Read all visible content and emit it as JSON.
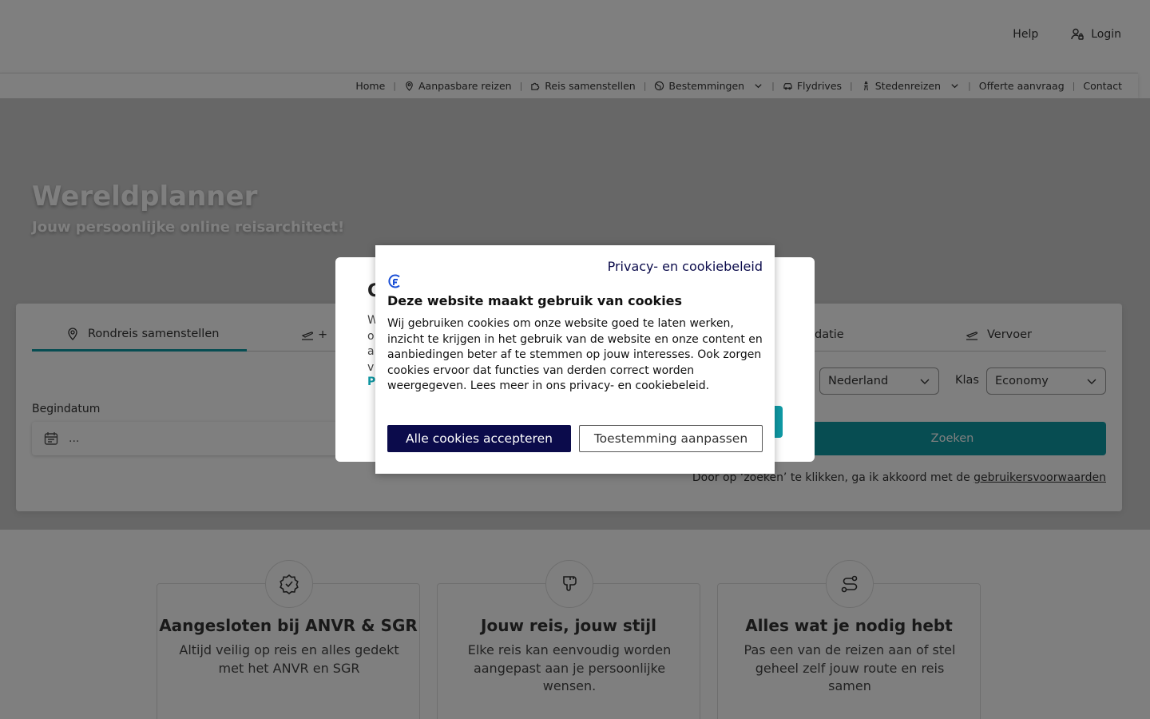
{
  "header": {
    "help": "Help",
    "login": "Login"
  },
  "nav": {
    "items": [
      {
        "label": "Home",
        "icon": ""
      },
      {
        "label": "Aanpasbare reizen",
        "icon": "map-pin-icon"
      },
      {
        "label": "Reis samenstellen",
        "icon": "puzzle-icon"
      },
      {
        "label": "Bestemmingen",
        "icon": "globe-icon",
        "dropdown": true
      },
      {
        "label": "Flydrives",
        "icon": "car-icon"
      },
      {
        "label": "Stedenreizen",
        "icon": "tower-icon",
        "dropdown": true
      },
      {
        "label": "Offerte aanvraag",
        "icon": ""
      },
      {
        "label": "Contact",
        "icon": ""
      }
    ]
  },
  "hero": {
    "title": "Wereldplanner",
    "subtitle": "Jouw persoonlijke online reisarchitect!"
  },
  "search": {
    "tabs": {
      "rondreis": "Rondreis samenstellen",
      "flight_prefix": "+",
      "accommodatie": "datie",
      "vervoer": "Vervoer"
    },
    "begindatum_label": "Begindatum",
    "date_placeholder": "...",
    "country_select": "Nederland",
    "klas_label": "Klas",
    "klas_select": "Economy",
    "search_button": "Zoeken",
    "terms_prefix": "Door op ‘zoeken’ te klikken, ga ik akkoord met de ",
    "terms_link": "gebruikersvoorwaarden"
  },
  "features": [
    {
      "title": "Aangesloten bij ANVR & SGR",
      "text": "Altijd veilig op reis en alles gedekt met het ANVR en SGR",
      "icon": "badge-check-icon"
    },
    {
      "title": "Jouw reis, jouw stijl",
      "text": "Elke reis kan eenvoudig worden aangepast aan je persoonlijke wensen.",
      "icon": "brush-icon"
    },
    {
      "title": "Alles wat je nodig hebt",
      "text": "Pas een van de reizen aan of stel geheel zelf jouw route en reis samen",
      "icon": "route-icon"
    }
  ],
  "back_dialog": {
    "title_fragment": "C",
    "text_fragment": "W\no\na\nv",
    "link_fragment": "P",
    "paren": ")"
  },
  "cookie": {
    "policy_link": "Privacy- en cookiebeleid",
    "title": "Deze website maakt gebruik van cookies",
    "text": "Wij gebruiken cookies om onze website goed te laten werken, inzicht te krijgen in het gebruik van de website en onze content en aanbiedingen beter af te stemmen op jouw interesses. Ook zorgen cookies ervoor dat functies van derden correct worden weergegeven. Lees meer in ons privacy- en cookiebeleid.",
    "accept_button": "Alle cookies accepteren",
    "customize_button": "Toestemming aanpassen"
  },
  "colors": {
    "accent": "#0f9aa5",
    "cookie_primary": "#0b0b4b"
  }
}
